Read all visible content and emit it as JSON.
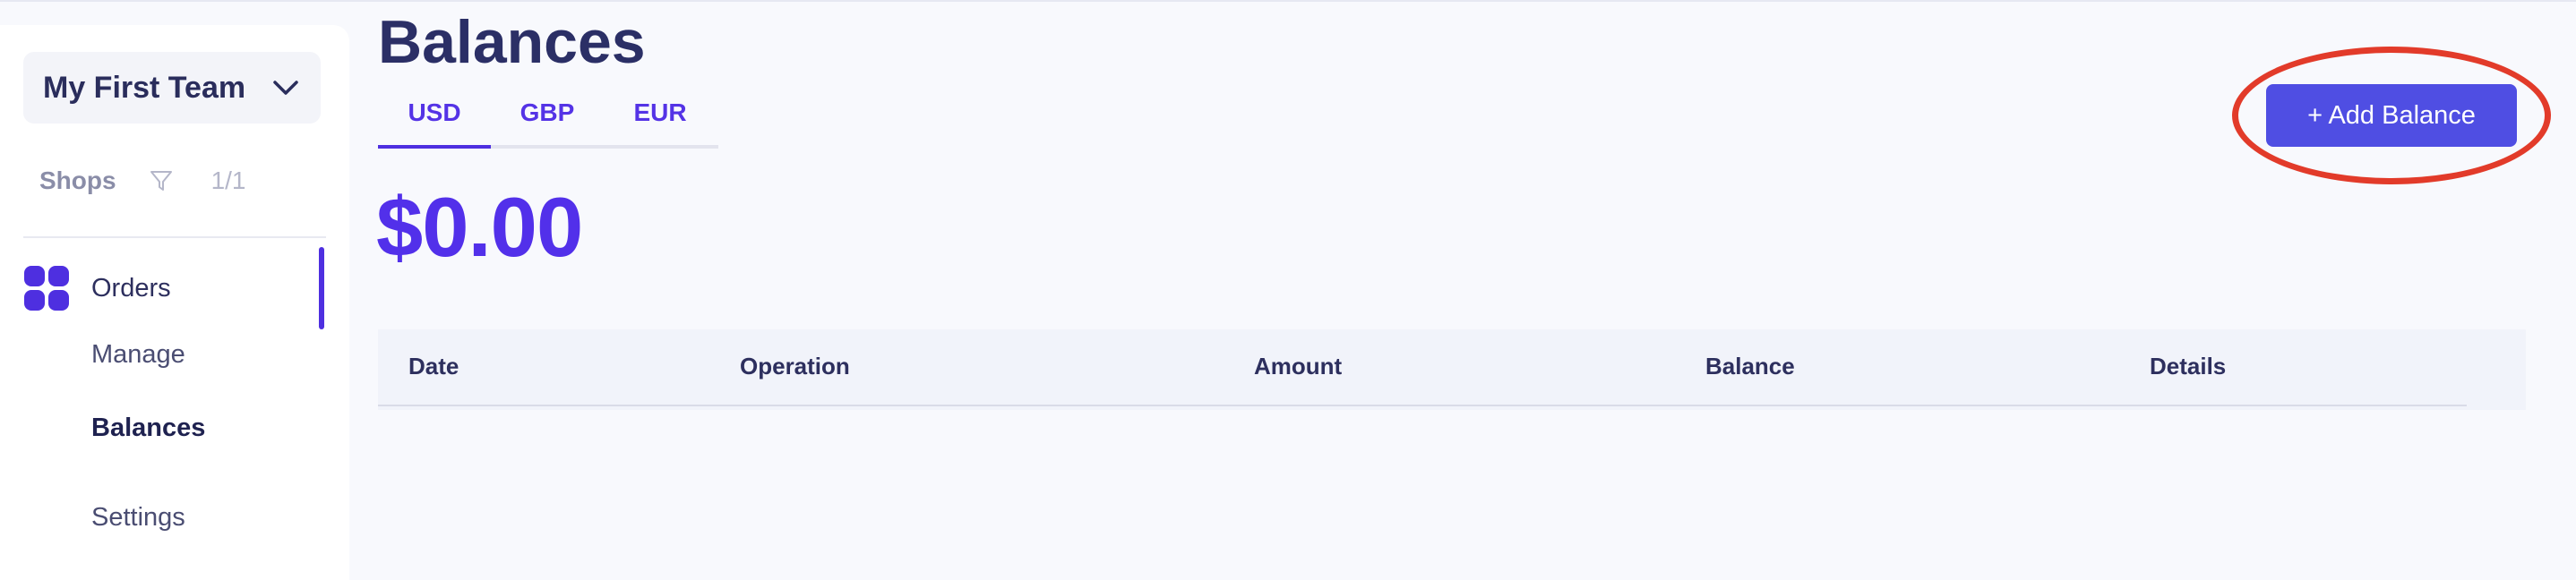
{
  "sidebar": {
    "team_name": "My First Team",
    "shops_label": "Shops",
    "shops_count": "1/1",
    "nav": {
      "orders_label": "Orders",
      "sub_items": [
        "Manage",
        "Balances",
        "Settings"
      ],
      "active_sub": "Balances"
    }
  },
  "main": {
    "title": "Balances",
    "tabs": [
      "USD",
      "GBP",
      "EUR"
    ],
    "active_tab": "USD",
    "amount": "$0.00",
    "add_button_label": "+ Add Balance",
    "table": {
      "columns": [
        "Date",
        "Operation",
        "Amount",
        "Balance",
        "Details"
      ],
      "rows": []
    }
  },
  "colors": {
    "accent": "#4e2fe0",
    "button": "#4f4ee3",
    "highlight": "#e23b2a",
    "title": "#2b2f66"
  },
  "icons": {
    "team_chevron": "chevron-down-icon",
    "shops_filter": "filter-icon",
    "orders": "grid-icon"
  }
}
